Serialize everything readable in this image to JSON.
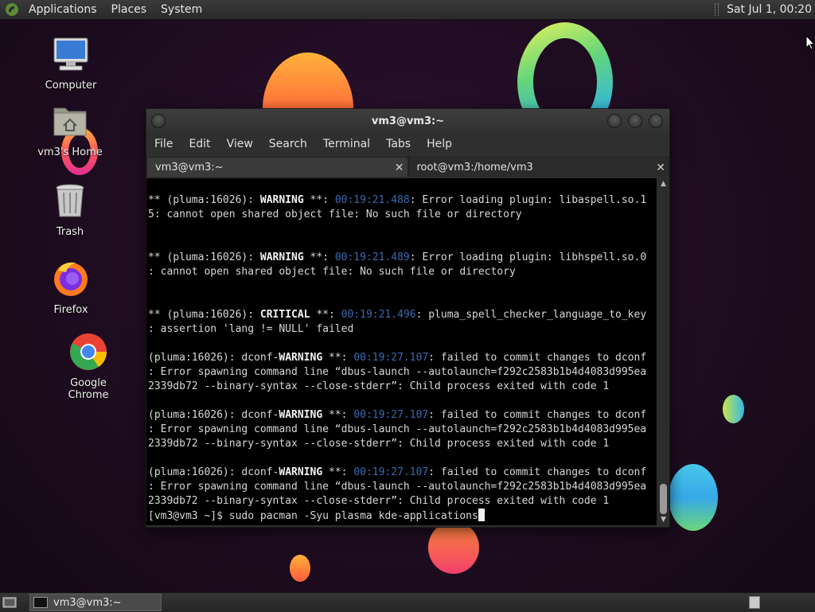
{
  "top_panel": {
    "menus": [
      "Applications",
      "Places",
      "System"
    ],
    "clock": "Sat Jul  1, 00:20"
  },
  "desktop_icons": {
    "computer": "Computer",
    "home": "vm3's Home",
    "trash": "Trash",
    "firefox": "Firefox",
    "chrome": "Google Chrome"
  },
  "terminal": {
    "title": "vm3@vm3:~",
    "menu": [
      "File",
      "Edit",
      "View",
      "Search",
      "Terminal",
      "Tabs",
      "Help"
    ],
    "tabs": [
      {
        "label": "vm3@vm3:~",
        "active": true
      },
      {
        "label": "root@vm3:/home/vm3",
        "active": false
      }
    ],
    "lines": [
      {
        "segs": [
          [
            "** (pluma:16026): ",
            ""
          ],
          [
            "WARNING",
            "kw"
          ],
          [
            " **: ",
            ""
          ],
          [
            "00:19:21.488",
            "ts"
          ],
          [
            ": Error loading plugin: libaspell.so.1",
            ""
          ]
        ]
      },
      {
        "segs": [
          [
            "5: cannot open shared object file: No such file or directory",
            ""
          ]
        ]
      },
      {
        "segs": [
          [
            "",
            ""
          ]
        ]
      },
      {
        "segs": [
          [
            "",
            ""
          ]
        ]
      },
      {
        "segs": [
          [
            "** (pluma:16026): ",
            ""
          ],
          [
            "WARNING",
            "kw"
          ],
          [
            " **: ",
            ""
          ],
          [
            "00:19:21.489",
            "ts"
          ],
          [
            ": Error loading plugin: libhspell.so.0",
            ""
          ]
        ]
      },
      {
        "segs": [
          [
            ": cannot open shared object file: No such file or directory",
            ""
          ]
        ]
      },
      {
        "segs": [
          [
            "",
            ""
          ]
        ]
      },
      {
        "segs": [
          [
            "",
            ""
          ]
        ]
      },
      {
        "segs": [
          [
            "** (pluma:16026): ",
            ""
          ],
          [
            "CRITICAL",
            "kw"
          ],
          [
            " **: ",
            ""
          ],
          [
            "00:19:21.496",
            "ts"
          ],
          [
            ": pluma_spell_checker_language_to_key",
            ""
          ]
        ]
      },
      {
        "segs": [
          [
            ": assertion 'lang != NULL' failed",
            ""
          ]
        ]
      },
      {
        "segs": [
          [
            "",
            ""
          ]
        ]
      },
      {
        "segs": [
          [
            "(pluma:16026): dconf-",
            ""
          ],
          [
            "WARNING",
            "kw"
          ],
          [
            " **: ",
            ""
          ],
          [
            "00:19:27.107",
            "ts"
          ],
          [
            ": failed to commit changes to dconf",
            ""
          ]
        ]
      },
      {
        "segs": [
          [
            ": Error spawning command line “dbus-launch --autolaunch=f292c2583b1b4d4083d995ea",
            ""
          ]
        ]
      },
      {
        "segs": [
          [
            "2339db72 --binary-syntax --close-stderr”: Child process exited with code 1",
            ""
          ]
        ]
      },
      {
        "segs": [
          [
            "",
            ""
          ]
        ]
      },
      {
        "segs": [
          [
            "(pluma:16026): dconf-",
            ""
          ],
          [
            "WARNING",
            "kw"
          ],
          [
            " **: ",
            ""
          ],
          [
            "00:19:27.107",
            "ts"
          ],
          [
            ": failed to commit changes to dconf",
            ""
          ]
        ]
      },
      {
        "segs": [
          [
            ": Error spawning command line “dbus-launch --autolaunch=f292c2583b1b4d4083d995ea",
            ""
          ]
        ]
      },
      {
        "segs": [
          [
            "2339db72 --binary-syntax --close-stderr”: Child process exited with code 1",
            ""
          ]
        ]
      },
      {
        "segs": [
          [
            "",
            ""
          ]
        ]
      },
      {
        "segs": [
          [
            "(pluma:16026): dconf-",
            ""
          ],
          [
            "WARNING",
            "kw"
          ],
          [
            " **: ",
            ""
          ],
          [
            "00:19:27.107",
            "ts"
          ],
          [
            ": failed to commit changes to dconf",
            ""
          ]
        ]
      },
      {
        "segs": [
          [
            ": Error spawning command line “dbus-launch --autolaunch=f292c2583b1b4d4083d995ea",
            ""
          ]
        ]
      },
      {
        "segs": [
          [
            "2339db72 --binary-syntax --close-stderr”: Child process exited with code 1",
            ""
          ]
        ]
      }
    ],
    "prompt": "[vm3@vm3 ~]$ ",
    "command": "sudo pacman -Syu plasma kde-applications"
  },
  "bottom_panel": {
    "task_label": "vm3@vm3:~"
  },
  "colors": {
    "desktop_bg": "#1e0c20",
    "terminal_bg": "#000000",
    "timestamp": "#3a6bb0"
  }
}
